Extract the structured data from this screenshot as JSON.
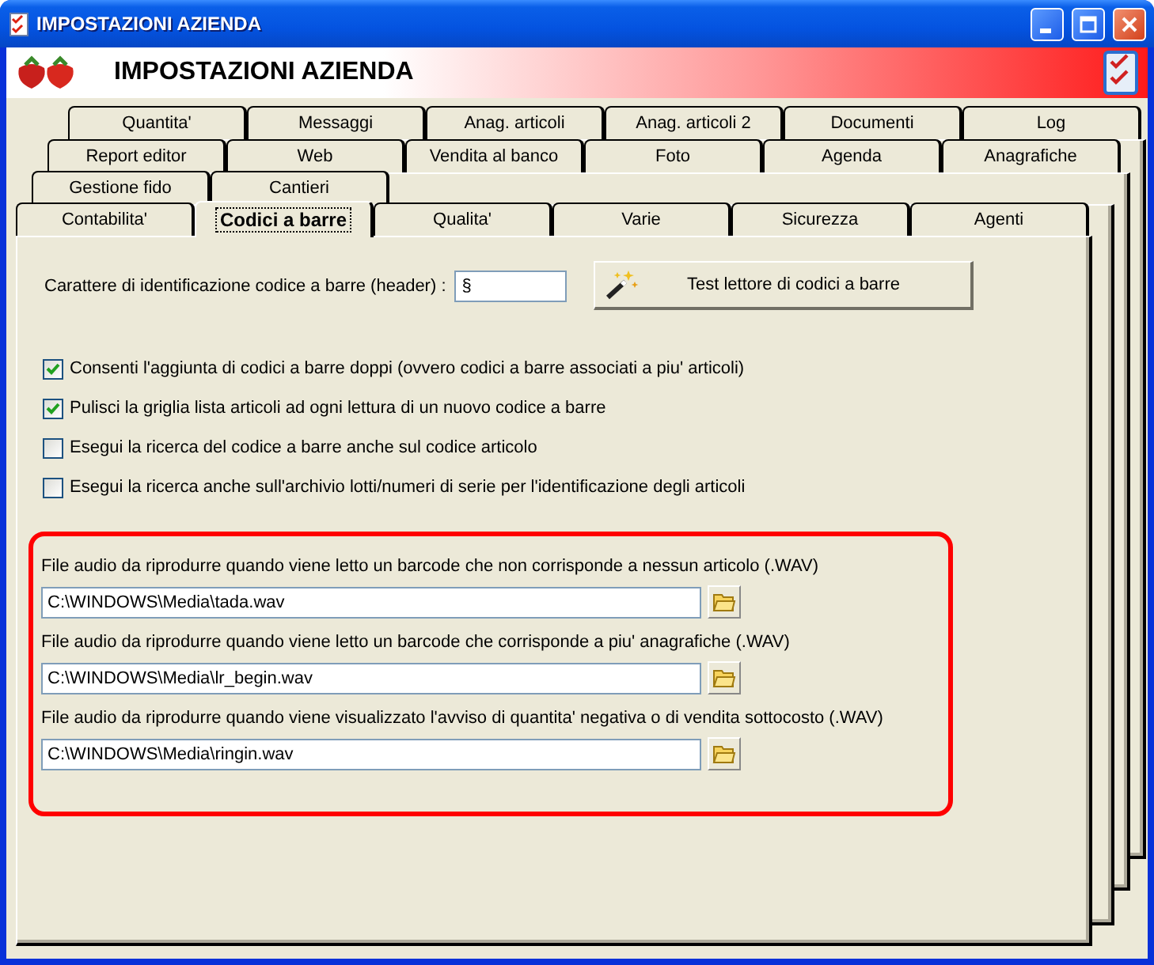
{
  "window": {
    "title": "IMPOSTAZIONI AZIENDA"
  },
  "header": {
    "title": "IMPOSTAZIONI AZIENDA"
  },
  "tab_rows": [
    {
      "tabs": [
        {
          "label": "Quantita'",
          "selected": false
        },
        {
          "label": "Messaggi",
          "selected": false
        },
        {
          "label": "Anag. articoli",
          "selected": false
        },
        {
          "label": "Anag. articoli 2",
          "selected": false
        },
        {
          "label": "Documenti",
          "selected": false
        },
        {
          "label": "Log",
          "selected": false
        }
      ]
    },
    {
      "tabs": [
        {
          "label": "Report editor",
          "selected": false
        },
        {
          "label": "Web",
          "selected": false
        },
        {
          "label": "Vendita al banco",
          "selected": false
        },
        {
          "label": "Foto",
          "selected": false
        },
        {
          "label": "Agenda",
          "selected": false
        },
        {
          "label": "Anagrafiche",
          "selected": false
        }
      ]
    },
    {
      "tabs": [
        {
          "label": "Gestione fido",
          "selected": false
        },
        {
          "label": "Cantieri",
          "selected": false
        }
      ]
    },
    {
      "tabs": [
        {
          "label": "Contabilita'",
          "selected": false
        },
        {
          "label": "Codici a barre",
          "selected": true
        },
        {
          "label": "Qualita'",
          "selected": false
        },
        {
          "label": "Varie",
          "selected": false
        },
        {
          "label": "Sicurezza",
          "selected": false
        },
        {
          "label": "Agenti",
          "selected": false
        }
      ]
    }
  ],
  "header_char": {
    "label": "Carattere di identificazione codice a barre (header) :",
    "value": "§"
  },
  "test_button": {
    "label": "Test lettore di codici a barre"
  },
  "checkboxes": [
    {
      "label": "Consenti l'aggiunta di codici a barre doppi (ovvero codici a barre associati a piu' articoli)",
      "checked": true
    },
    {
      "label": "Pulisci la griglia lista articoli ad ogni lettura di un nuovo codice a barre",
      "checked": true
    },
    {
      "label": "Esegui la ricerca del codice a barre anche sul codice articolo",
      "checked": false
    },
    {
      "label": "Esegui la ricerca anche sull'archivio lotti/numeri di serie per l'identificazione degli articoli",
      "checked": false
    }
  ],
  "audio_files": [
    {
      "label": "File audio da riprodurre quando viene letto un barcode che non corrisponde a nessun articolo (.WAV)",
      "value": "C:\\WINDOWS\\Media\\tada.wav"
    },
    {
      "label": "File audio da riprodurre quando viene letto un barcode che corrisponde a piu' anagrafiche (.WAV)",
      "value": "C:\\WINDOWS\\Media\\lr_begin.wav"
    },
    {
      "label": "File audio da riprodurre quando viene visualizzato l'avviso di quantita' negativa o di vendita sottocosto (.WAV)",
      "value": "C:\\WINDOWS\\Media\\ringin.wav"
    }
  ]
}
